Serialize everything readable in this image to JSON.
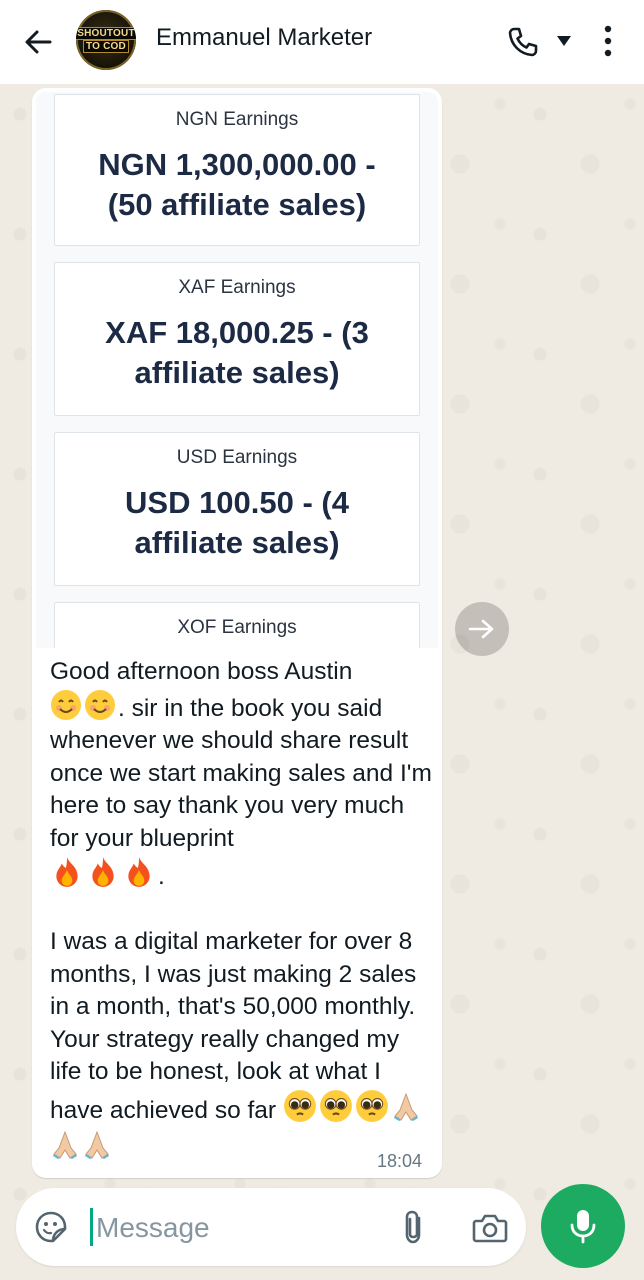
{
  "header": {
    "contact_name": "Emmanuel Marketer",
    "avatar_text_line1": "SHOUTOUT",
    "avatar_text_line2": "TO COD",
    "icons": [
      "back-arrow-icon",
      "phone-call-icon",
      "chevron-down-icon",
      "more-vertical-icon"
    ]
  },
  "earnings_cards": [
    {
      "label": "NGN Earnings",
      "value": "NGN 1,300,000.00 - (50 affiliate sales)"
    },
    {
      "label": "XAF Earnings",
      "value": "XAF 18,000.25 - (3 affiliate sales)"
    },
    {
      "label": "USD Earnings",
      "value": "USD 100.50 - (4 affiliate sales)"
    },
    {
      "label": "XOF Earnings",
      "value": ""
    }
  ],
  "message": {
    "para1_start": "Good afternoon boss Austin",
    "para1_after_emoji": ". sir in the book you said whenever we should share result once we start making sales and I'm here to say thank you very much for your blueprint",
    "para1_end": ".",
    "para2": "I was a digital marketer for over 8 months, I was just making 2 sales in a month, that's 50,000 monthly. Your strategy really changed my life to be honest, look at what I have achieved so far",
    "emojis": [
      "smiling-face-emoji",
      "fire-emoji",
      "pleading-face-emoji",
      "folded-hands-emoji"
    ],
    "timestamp": "18:04"
  },
  "composer": {
    "placeholder": "Message",
    "icons": [
      "sticker-icon",
      "paperclip-icon",
      "camera-icon",
      "microphone-icon"
    ]
  },
  "colors": {
    "accent_green": "#1daa61",
    "chat_background": "#efeae2",
    "bubble": "#ffffff",
    "card_value_text": "#1c2a44"
  }
}
